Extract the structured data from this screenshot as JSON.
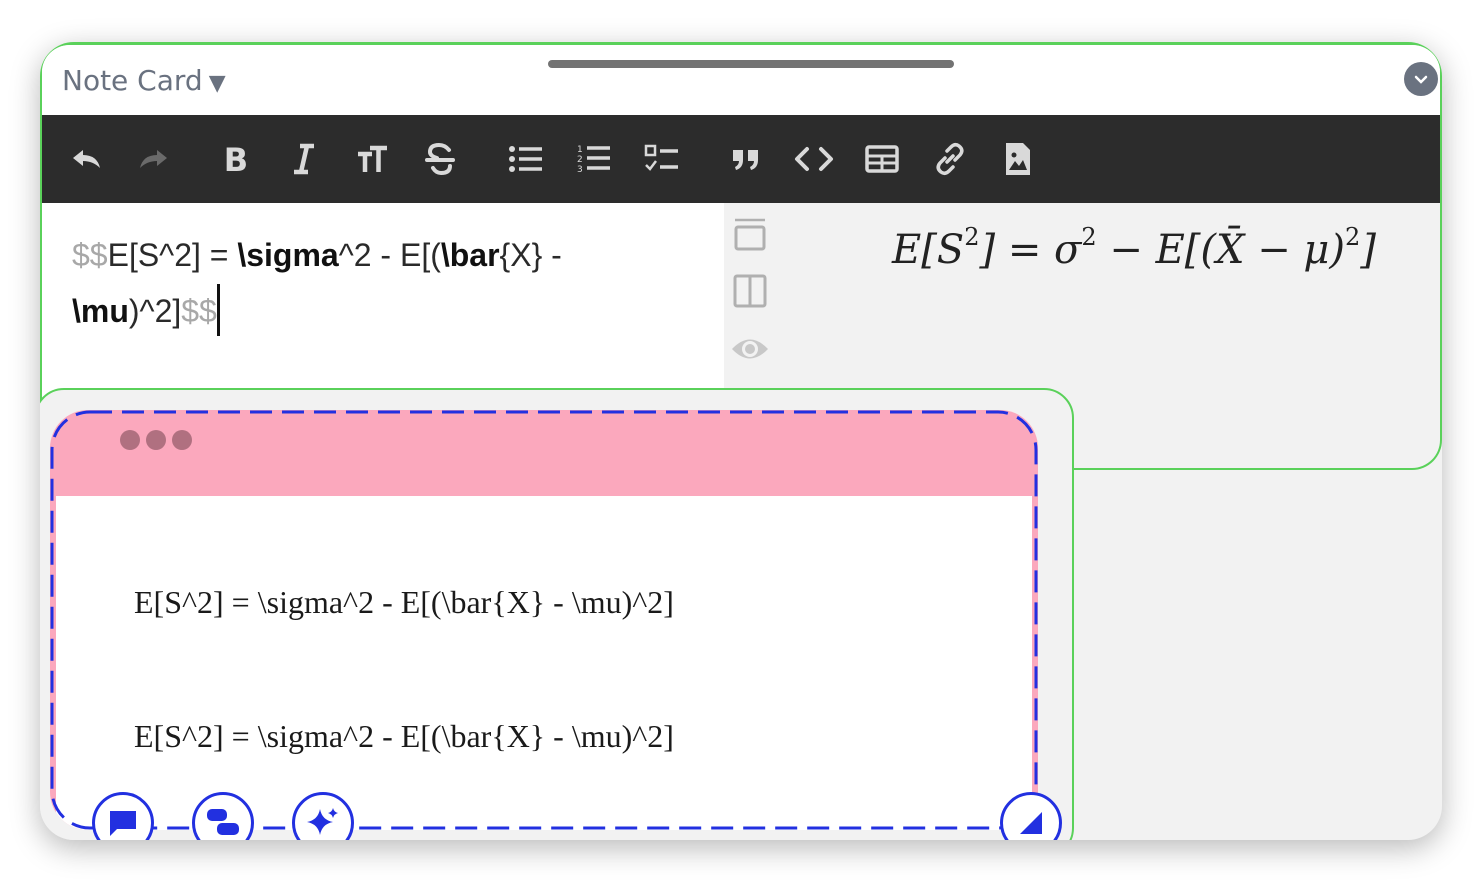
{
  "card": {
    "title": "Note Card",
    "caret": "▼"
  },
  "toolbar": {
    "buttons": [
      "undo",
      "redo",
      "bold",
      "italic",
      "heading",
      "strikethrough",
      "bullet-list",
      "numbered-list",
      "task-list",
      "quote",
      "code",
      "table",
      "link",
      "image"
    ]
  },
  "editor": {
    "open_delim": "$$",
    "seg1": "E[S^2] = ",
    "cmd_sigma": "\\sigma",
    "seg2": "^2 - E[(",
    "cmd_bar": "\\bar",
    "seg3": "{X} -",
    "cmd_mu": "\\mu",
    "seg4": ")^2]",
    "close_delim": "$$"
  },
  "preview": {
    "p1": "E[S",
    "sup1": "2",
    "p2": "] = σ",
    "sup2": "2",
    "p3": " − E[(X̄ − μ)",
    "sup3": "2",
    "p4": "]"
  },
  "note": {
    "line1": "E[S^2] = \\sigma^2 - E[(\\bar{X} - \\mu)^2]",
    "line2": "E[S^2] = \\sigma^2 - E[(\\bar{X} - \\mu)^2]"
  },
  "colors": {
    "toolbar_bg": "#2c2c2c",
    "accent_green": "#5ad15a",
    "note_pink": "#fba8bd",
    "fab_blue": "#2230e0"
  }
}
